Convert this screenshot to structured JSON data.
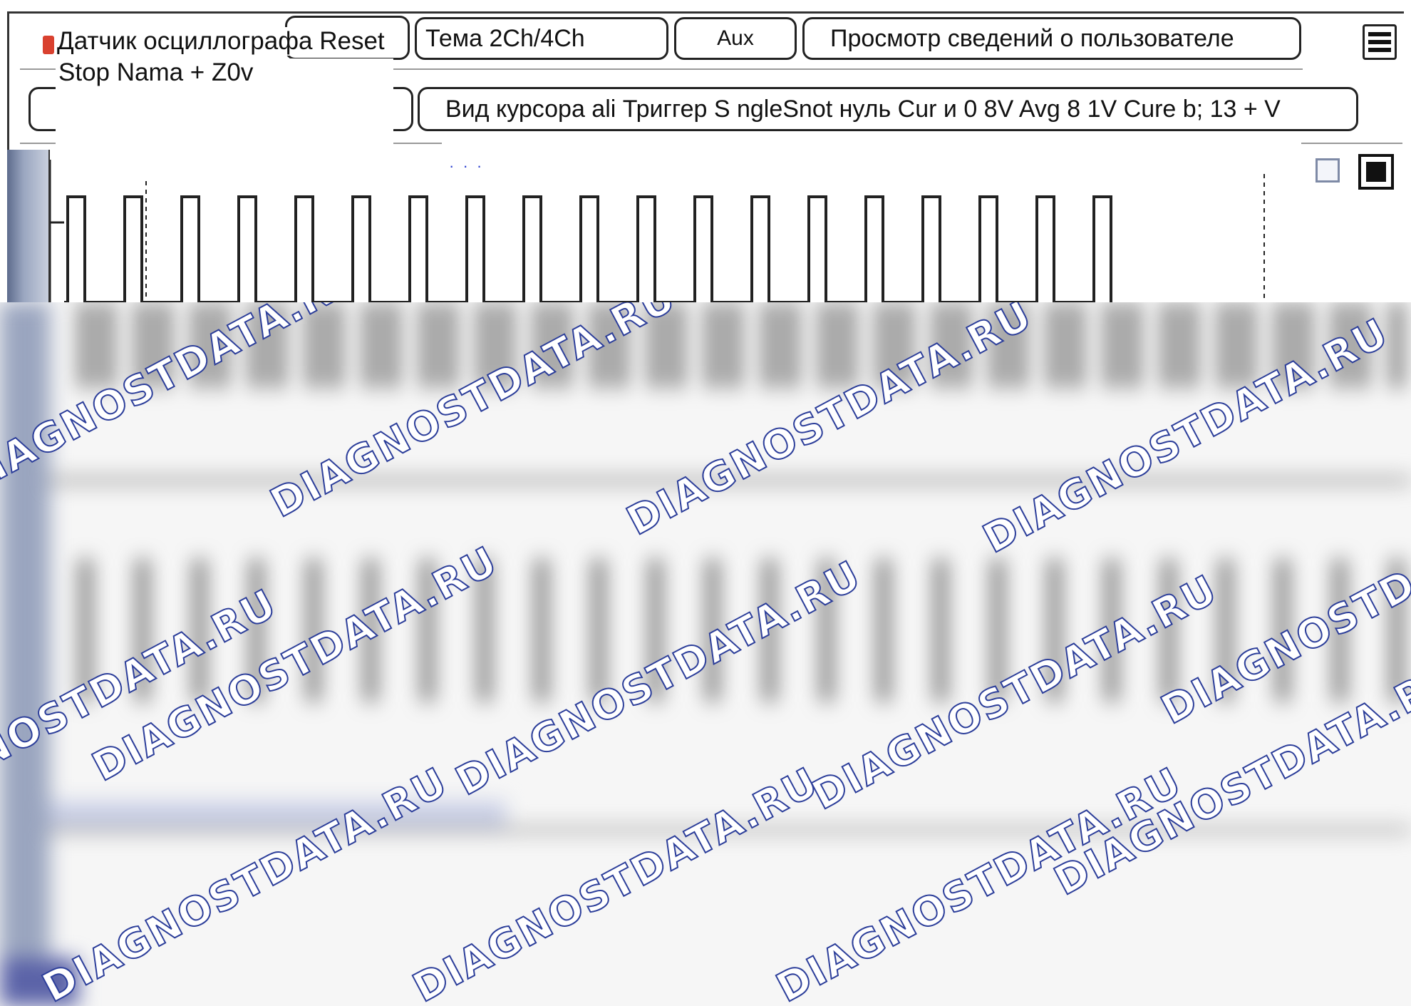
{
  "toolbar": {
    "title_label": "Датчик осциллографа Reset",
    "theme_label": "Тема 2Ch/4Ch",
    "aux_label": "Aux",
    "user_info_label": "Просмотр сведений о пользователе",
    "status_line": "Stop Nama + Z0v",
    "cursor_info": "Вид курсора ali Триггер S ngleSnot нуль Cur и 0 8V Avg 8 1V Cure b; 13 + V",
    "marker_text": "· · ·"
  },
  "watermark": {
    "text": "DIAGNOSTDATA.RU"
  },
  "colors": {
    "trace": "#222222",
    "watermark_stroke": "#2c3e9a",
    "rail": "#8a96b2",
    "close_marker": "#d9412f"
  },
  "icons": {
    "menu": "hamburger-icon",
    "window_empty": "square-outline-icon",
    "window_filled": "square-filled-icon"
  }
}
